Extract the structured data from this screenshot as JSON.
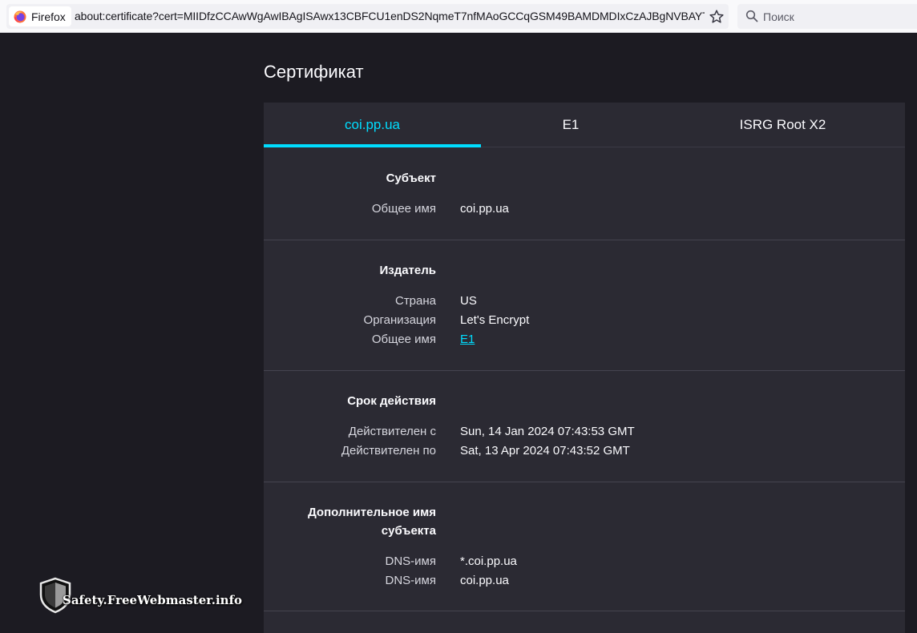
{
  "browser": {
    "identity_label": "Firefox",
    "url": "about:certificate?cert=MIIDfzCCAwWgAwIBAgISAwx13CBFCU1enDS2NqmeT7nfMAoGCCqGSM49BAMDMDIxCzAJBgNVBAYTAlV",
    "search_placeholder": "Поиск"
  },
  "page": {
    "title": "Сертификат"
  },
  "tabs": [
    {
      "label": "coi.pp.ua",
      "active": true
    },
    {
      "label": "E1",
      "active": false
    },
    {
      "label": "ISRG Root X2",
      "active": false
    }
  ],
  "subject": {
    "title": "Субъект",
    "rows": [
      {
        "label": "Общее имя",
        "value": "coi.pp.ua"
      }
    ]
  },
  "issuer": {
    "title": "Издатель",
    "rows": [
      {
        "label": "Страна",
        "value": "US"
      },
      {
        "label": "Организация",
        "value": "Let's Encrypt"
      },
      {
        "label": "Общее имя",
        "value": "E1"
      }
    ]
  },
  "validity": {
    "title": "Срок действия",
    "rows": [
      {
        "label": "Действителен с",
        "value": "Sun, 14 Jan 2024 07:43:53 GMT"
      },
      {
        "label": "Действителен по",
        "value": "Sat, 13 Apr 2024 07:43:52 GMT"
      }
    ]
  },
  "san": {
    "title_line1": "Дополнительное имя",
    "title_line2": "субъекта",
    "rows": [
      {
        "label": "DNS-имя",
        "value": "*.coi.pp.ua"
      },
      {
        "label": "DNS-имя",
        "value": "coi.pp.ua"
      }
    ]
  },
  "watermark": {
    "text": "Safety.FreeWebmaster.info"
  },
  "colors": {
    "accent": "#00ddff",
    "background": "#1c1b22",
    "card": "#2b2a33"
  }
}
